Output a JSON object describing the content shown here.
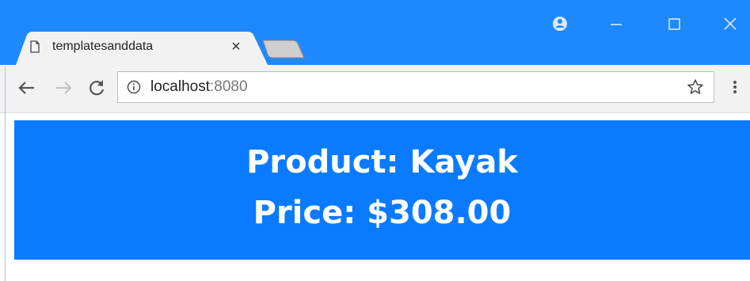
{
  "browser": {
    "tab": {
      "title": "templatesanddata",
      "close_glyph": "×",
      "icon": "page-icon"
    },
    "new_tab_icon": "new-tab-icon",
    "window_controls": {
      "profile_icon": "profile-icon",
      "minimize_icon": "minimize-icon",
      "maximize_icon": "maximize-icon",
      "close_icon": "close-icon"
    },
    "toolbar": {
      "back_icon": "back-arrow-icon",
      "forward_icon": "forward-arrow-icon",
      "reload_icon": "reload-icon",
      "info_icon": "info-icon",
      "url_host": "localhost",
      "url_port": ":8080",
      "bookmark_icon": "star-icon",
      "menu_icon": "kebab-menu-icon"
    },
    "colors": {
      "titlebar": "#1e88ff",
      "toolbar": "#f2f2f2",
      "banner": "#0a7bff",
      "banner_text": "#ffffff"
    }
  },
  "page": {
    "product_line": "Product: Kayak",
    "price_line": "Price: $308.00"
  }
}
